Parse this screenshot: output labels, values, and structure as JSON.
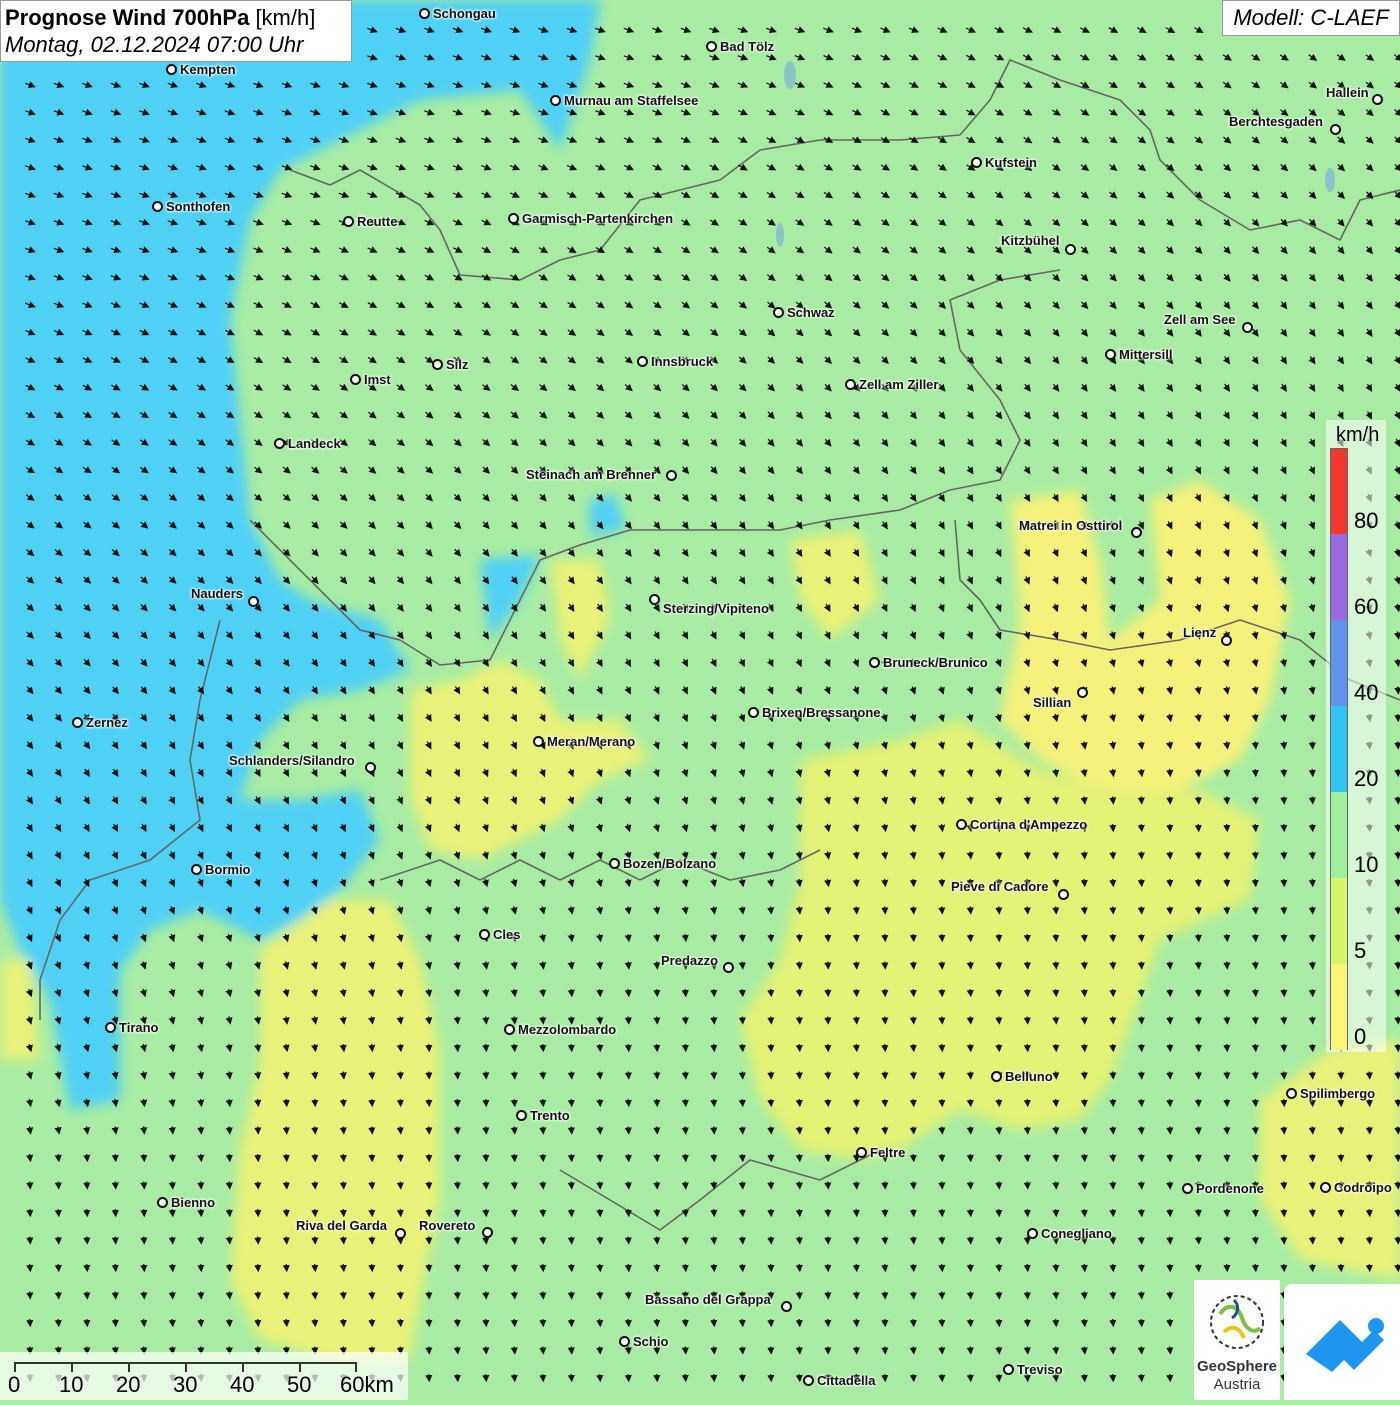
{
  "header": {
    "title_bold": "Prognose Wind 700hPa",
    "title_unit": "[km/h]",
    "subtitle": "Montag, 02.12.2024 07:00 Uhr",
    "model": "Modell: C-LAEF"
  },
  "legend": {
    "unit": "km/h",
    "ticks": [
      "0",
      "5",
      "10",
      "20",
      "40",
      "60",
      "80"
    ],
    "colors": [
      "#fbf67a",
      "#d5f56a",
      "#9ef09c",
      "#31c6f0",
      "#5f92ea",
      "#9a6ae0",
      "#f2372e"
    ]
  },
  "scalebar": {
    "labels": [
      "0",
      "10",
      "20",
      "30",
      "40",
      "50",
      "60km"
    ]
  },
  "logos": {
    "geosphere_name": "GeoSphere",
    "geosphere_sub": "Austria",
    "app_icon": "mountain-logo-icon"
  },
  "cities": [
    {
      "name": "Schongau"
    },
    {
      "name": "Bad Tölz"
    },
    {
      "name": "Kempten"
    },
    {
      "name": "Murnau am Staffelsee"
    },
    {
      "name": "Hallein"
    },
    {
      "name": "Berchtesgaden"
    },
    {
      "name": "Kufstein"
    },
    {
      "name": "Sonthofen"
    },
    {
      "name": "Reutte"
    },
    {
      "name": "Garmisch-Partenkirchen"
    },
    {
      "name": "Kitzbühel"
    },
    {
      "name": "Schwaz"
    },
    {
      "name": "Zell am See"
    },
    {
      "name": "Mittersill"
    },
    {
      "name": "Innsbruck"
    },
    {
      "name": "Silz"
    },
    {
      "name": "Imst"
    },
    {
      "name": "Zell am Ziller"
    },
    {
      "name": "Landeck"
    },
    {
      "name": "Steinach am Brenner"
    },
    {
      "name": "Matrei in Osttirol"
    },
    {
      "name": "Nauders"
    },
    {
      "name": "Sterzing/Vipiteno"
    },
    {
      "name": "Lienz"
    },
    {
      "name": "Bruneck/Brunico"
    },
    {
      "name": "Sillian"
    },
    {
      "name": "Brixen/Bressanone"
    },
    {
      "name": "Zernez"
    },
    {
      "name": "Meran/Merano"
    },
    {
      "name": "Schlanders/Silandro"
    },
    {
      "name": "Cortina d'Ampezzo"
    },
    {
      "name": "Bozen/Bolzano"
    },
    {
      "name": "Bormio"
    },
    {
      "name": "Pieve di Cadore"
    },
    {
      "name": "Cles"
    },
    {
      "name": "Predazzo"
    },
    {
      "name": "Tirano"
    },
    {
      "name": "Mezzolombardo"
    },
    {
      "name": "Belluno"
    },
    {
      "name": "Spilimbergo"
    },
    {
      "name": "Trento"
    },
    {
      "name": "Feltre"
    },
    {
      "name": "Pordenone"
    },
    {
      "name": "Codroipo"
    },
    {
      "name": "Bienno"
    },
    {
      "name": "Riva del Garda"
    },
    {
      "name": "Rovereto"
    },
    {
      "name": "Conegliano"
    },
    {
      "name": "Bassano del Grappa"
    },
    {
      "name": "Schio"
    },
    {
      "name": "Treviso"
    },
    {
      "name": "Cittadella"
    }
  ]
}
